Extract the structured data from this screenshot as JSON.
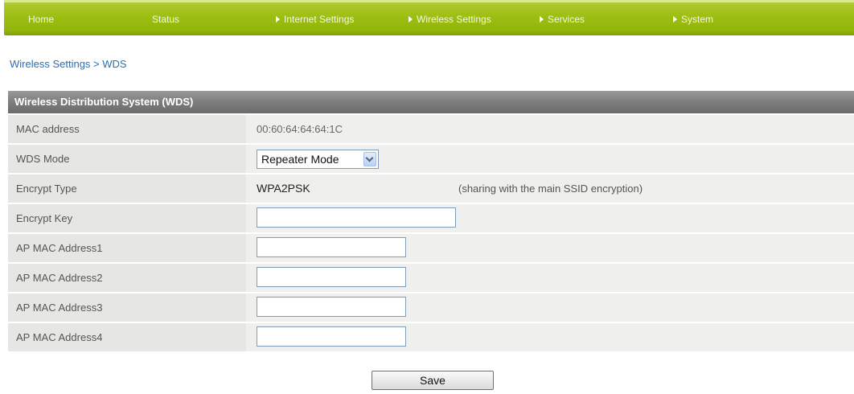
{
  "nav": {
    "items": [
      {
        "label": "Home",
        "has_arrow": false
      },
      {
        "label": "Status",
        "has_arrow": false
      },
      {
        "label": "Internet Settings",
        "has_arrow": true
      },
      {
        "label": "Wireless Settings",
        "has_arrow": true
      },
      {
        "label": "Services",
        "has_arrow": true
      },
      {
        "label": "System",
        "has_arrow": true
      }
    ],
    "arrow_icon": "triangle-right-icon",
    "bar_color": "#9cbd10"
  },
  "breadcrumb": {
    "parent": "Wireless Settings",
    "separator": " > ",
    "current": "WDS"
  },
  "panel": {
    "title": "Wireless Distribution System (WDS)",
    "mac_label": "MAC address",
    "mac_value": "00:60:64:64:64:1C",
    "wds_mode_label": "WDS Mode",
    "wds_mode_value": "Repeater Mode",
    "encrypt_type_label": "Encrypt Type",
    "encrypt_type_value": "WPA2PSK",
    "encrypt_type_note": "(sharing with the main SSID encryption)",
    "encrypt_key_label": "Encrypt Key",
    "encrypt_key_value": "",
    "ap_mac_1_label": "AP MAC Address1",
    "ap_mac_1_value": "",
    "ap_mac_2_label": "AP MAC Address2",
    "ap_mac_2_value": "",
    "ap_mac_3_label": "AP MAC Address3",
    "ap_mac_3_value": "",
    "ap_mac_4_label": "AP MAC Address4",
    "ap_mac_4_value": ""
  },
  "actions": {
    "save_label": "Save"
  },
  "colors": {
    "link": "#2a6fb2",
    "header_bg": "#7a7a7a",
    "row_bg": "#efefed"
  }
}
